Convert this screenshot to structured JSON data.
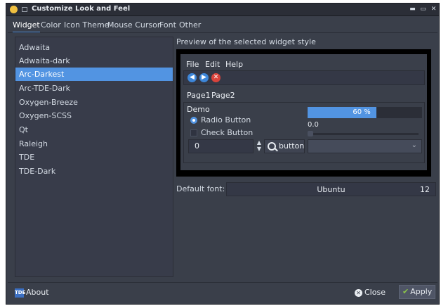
{
  "window": {
    "title": "Customize Look and Feel",
    "controls": {
      "minimize": "▬",
      "maximize": "▭",
      "close": "✕"
    }
  },
  "tabs": [
    "Widget",
    "Color",
    "Icon Theme",
    "Mouse Cursor",
    "Font",
    "Other"
  ],
  "active_tab": "Widget",
  "styles": [
    "Adwaita",
    "Adwaita-dark",
    "Arc-Darkest",
    "Arc-TDE-Dark",
    "Oxygen-Breeze",
    "Oxygen-SCSS",
    "Qt",
    "Raleigh",
    "TDE",
    "TDE-Dark"
  ],
  "selected_style": "Arc-Darkest",
  "preview": {
    "label": "Preview of the selected widget style",
    "menu": [
      "File",
      "Edit",
      "Help"
    ],
    "toolbar_icons": [
      "back-icon",
      "forward-icon",
      "stop-icon"
    ],
    "tabs": [
      "Page1",
      "Page2"
    ],
    "demo_label": "Demo",
    "radio_label": "Radio Button",
    "check_label": "Check Button",
    "spin_value": "0",
    "tool_button_label": "button",
    "progress_fraction": 0.6,
    "progress_text": "60 %",
    "slider_value_text": "0.0"
  },
  "font": {
    "label": "Default font:",
    "name": "Ubuntu",
    "size": "12"
  },
  "buttons": {
    "about": "About",
    "close": "Close",
    "apply": "Apply"
  },
  "colors": {
    "accent": "#5294e2",
    "window_bg": "#3a3f4a",
    "list_bg": "#383c4a",
    "preview_frame": "#000000"
  }
}
